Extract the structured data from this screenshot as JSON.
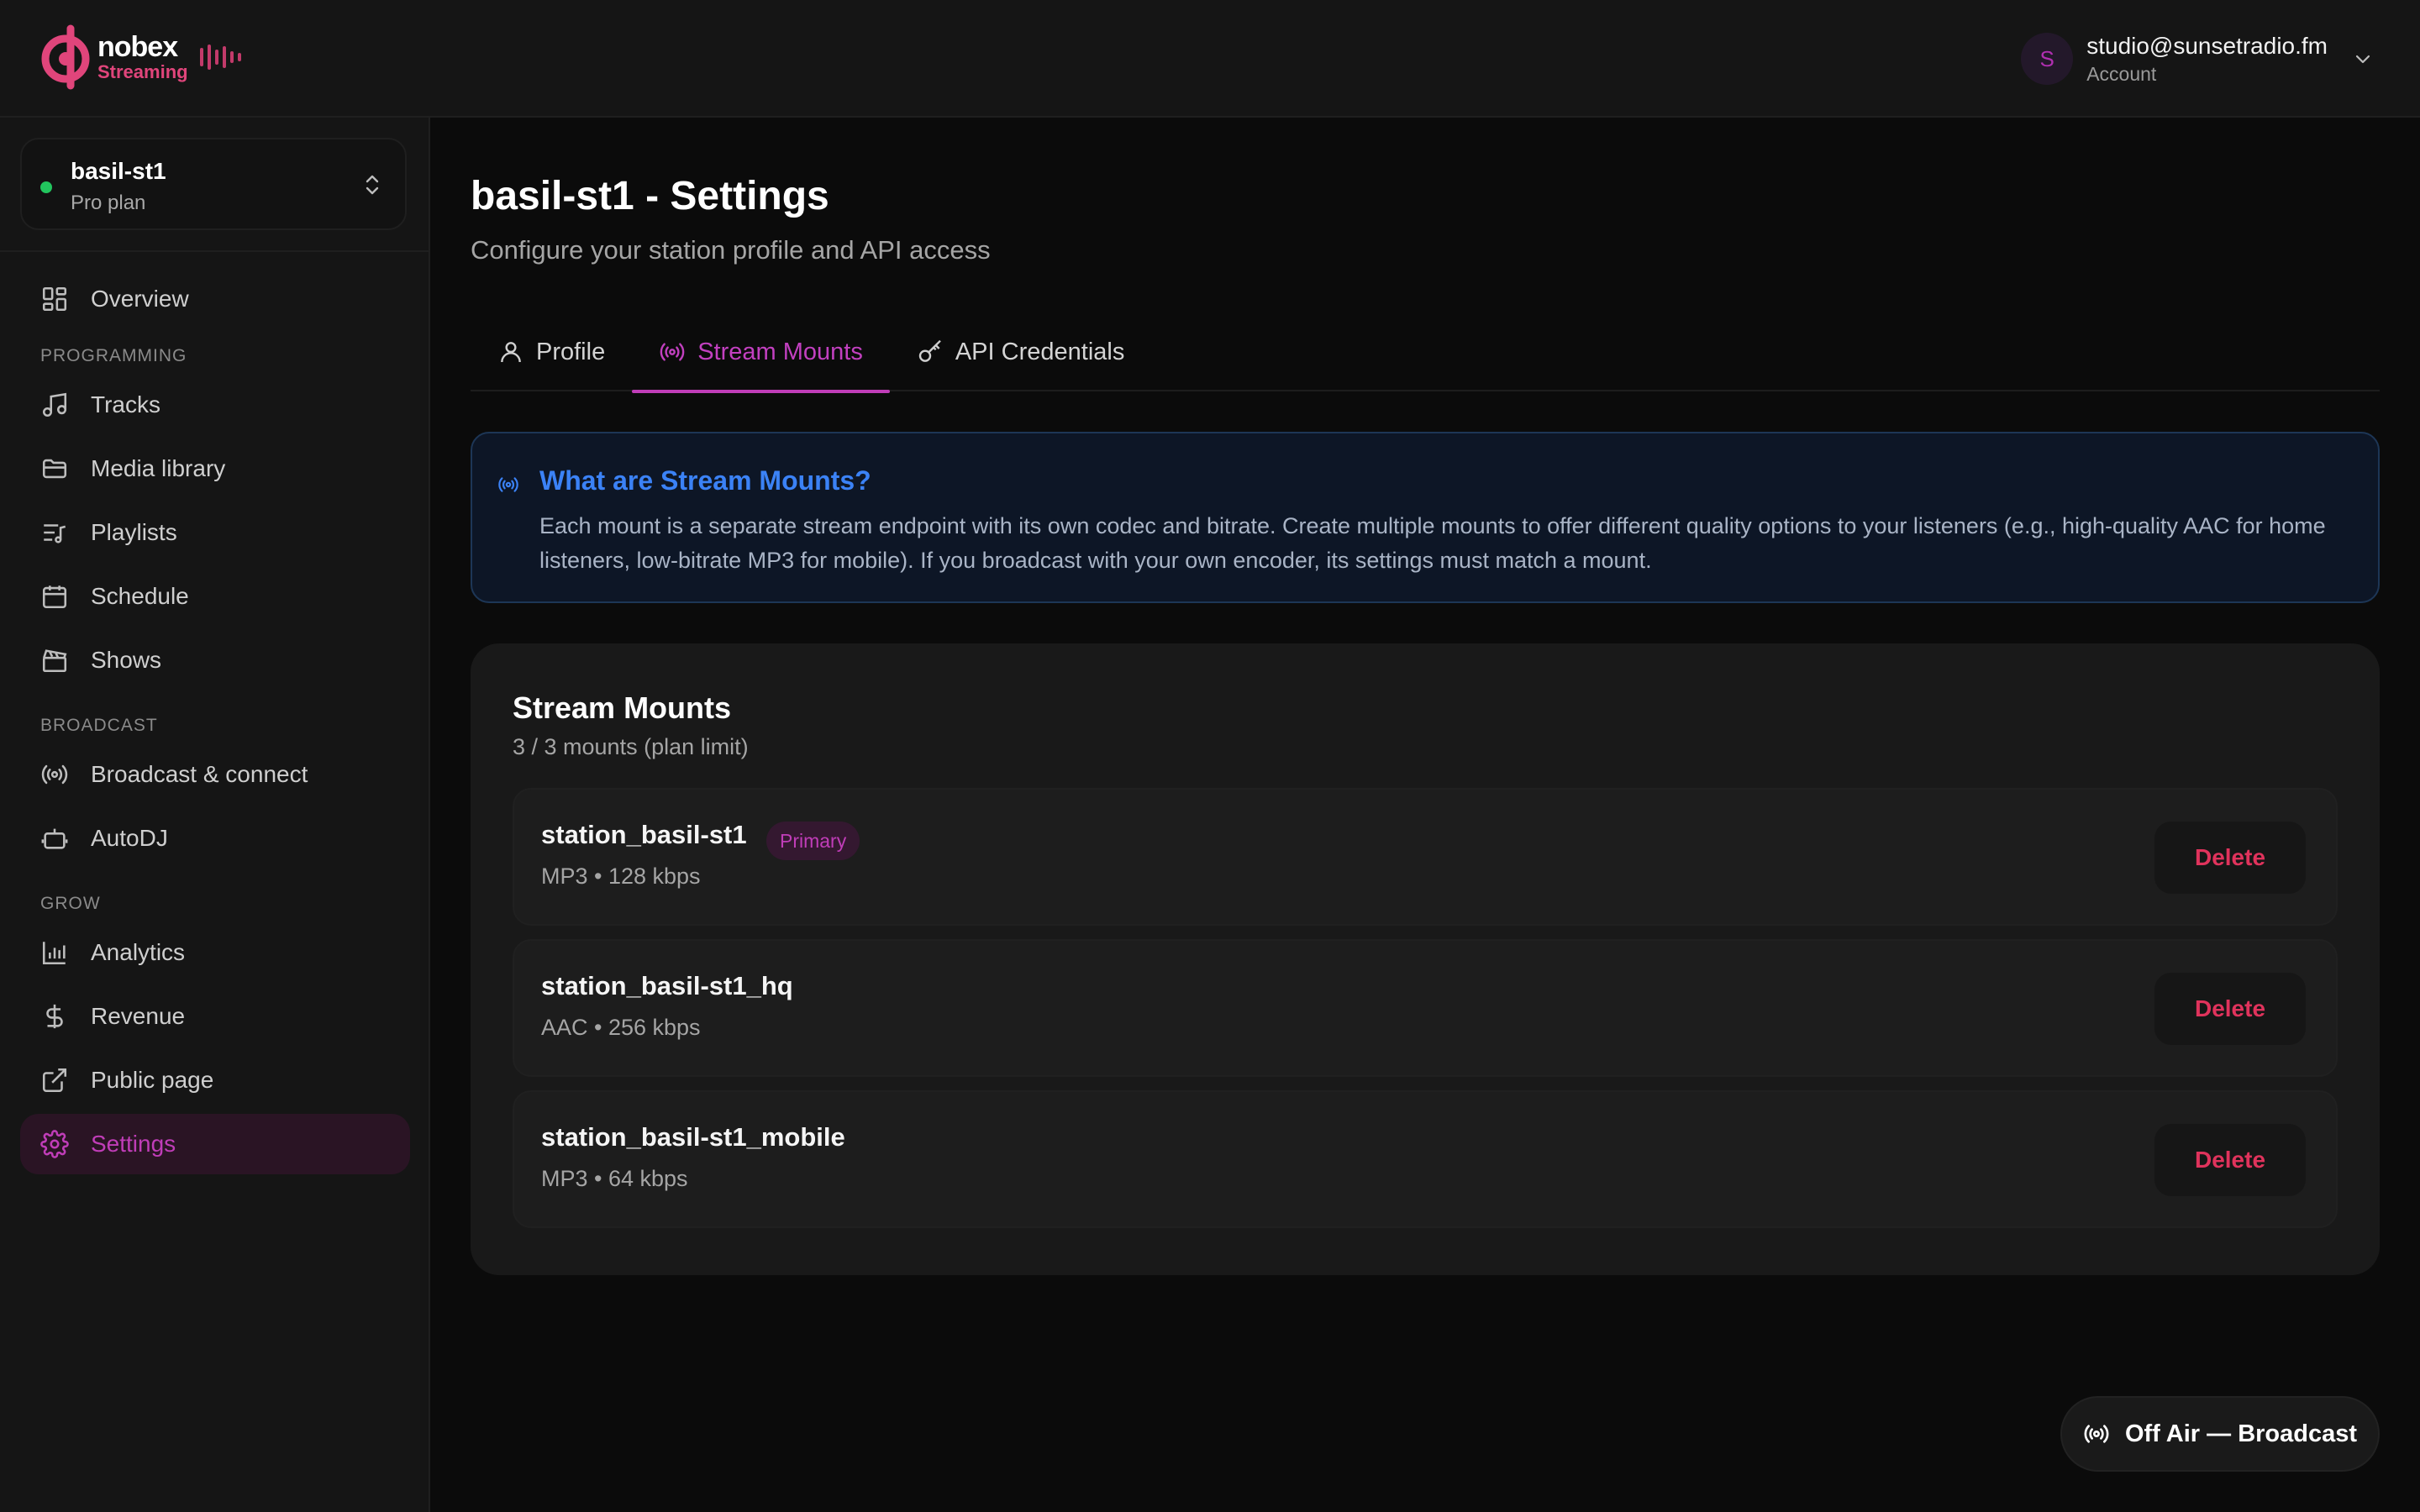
{
  "header": {
    "logo_text": "nobex",
    "logo_sub": "Streaming",
    "account_initial": "S",
    "account_email": "studio@sunsetradio.fm",
    "account_label": "Account"
  },
  "station": {
    "name": "basil-st1",
    "plan": "Pro plan",
    "status_color": "#22c55e"
  },
  "sidebar": {
    "overview": "Overview",
    "sections": {
      "programming": "PROGRAMMING",
      "broadcast": "BROADCAST",
      "grow": "GROW"
    },
    "items": {
      "tracks": "Tracks",
      "media_library": "Media library",
      "playlists": "Playlists",
      "schedule": "Schedule",
      "shows": "Shows",
      "broadcast_connect": "Broadcast & connect",
      "autodj": "AutoDJ",
      "analytics": "Analytics",
      "revenue": "Revenue",
      "public_page": "Public page",
      "settings": "Settings"
    },
    "active_item": "settings"
  },
  "page": {
    "title": "basil-st1 - Settings",
    "subtitle": "Configure your station profile and API access"
  },
  "tabs": [
    {
      "label": "Profile",
      "icon": "user-icon",
      "active": false
    },
    {
      "label": "Stream Mounts",
      "icon": "broadcast-icon",
      "active": true
    },
    {
      "label": "API Credentials",
      "icon": "key-icon",
      "active": false
    }
  ],
  "info": {
    "title": "What are Stream Mounts?",
    "text": "Each mount is a separate stream endpoint with its own codec and bitrate. Create multiple mounts to offer different quality options to your listeners (e.g., high-quality AAC for home listeners, low-bitrate MP3 for mobile). If you broadcast with your own encoder, its settings must match a mount."
  },
  "mounts_card": {
    "title": "Stream Mounts",
    "subtitle": "3 / 3 mounts (plan limit)",
    "delete_label": "Delete",
    "mounts": [
      {
        "name": "station_basil-st1",
        "meta": "MP3 • 128 kbps",
        "badge": "Primary"
      },
      {
        "name": "station_basil-st1_hq",
        "meta": "AAC • 256 kbps",
        "badge": ""
      },
      {
        "name": "station_basil-st1_mobile",
        "meta": "MP3 • 64 kbps",
        "badge": ""
      }
    ]
  },
  "floating": {
    "broadcast_label": "Off Air — Broadcast"
  },
  "colors": {
    "accent": "#c03db8",
    "brand": "#e0457b",
    "info_blue": "#3b82f6",
    "danger": "#e0335c"
  }
}
